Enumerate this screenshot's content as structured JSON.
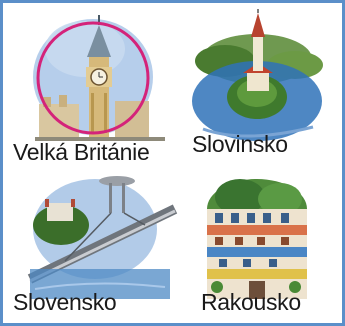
{
  "tiles": [
    {
      "label": "Velká Británie",
      "selected": true,
      "icon": "big-ben-illustration"
    },
    {
      "label": "Slovinsko",
      "selected": false,
      "icon": "bled-island-church-illustration"
    },
    {
      "label": "Slovensko",
      "selected": false,
      "icon": "bratislava-ufo-bridge-illustration"
    },
    {
      "label": "Rakousko",
      "selected": false,
      "icon": "hundertwasser-house-illustration"
    }
  ],
  "colors": {
    "frame": "#5b8fc9",
    "selection_ring": "#d4237a"
  }
}
